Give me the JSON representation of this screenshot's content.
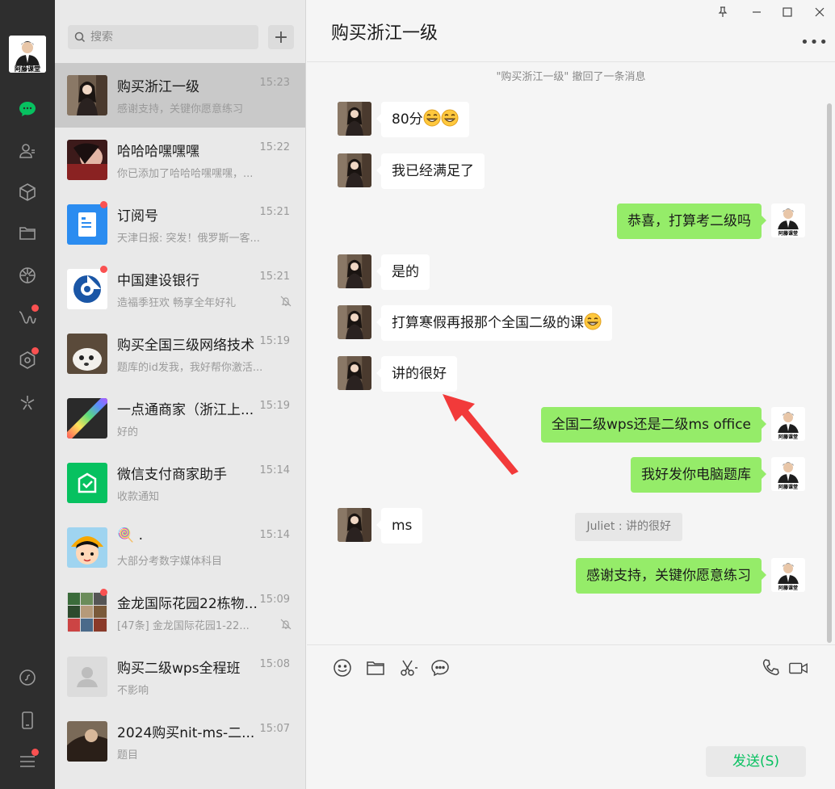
{
  "rail": {
    "my_avatar_text": "阿藤课堂",
    "items": [
      {
        "name": "chat-icon"
      },
      {
        "name": "contacts-icon"
      },
      {
        "name": "favorites-icon"
      },
      {
        "name": "files-icon"
      },
      {
        "name": "moments-icon"
      },
      {
        "name": "channels-icon"
      },
      {
        "name": "mini-programs-icon"
      },
      {
        "name": "search-discover-icon"
      }
    ],
    "bottom": [
      {
        "name": "mini-program-panel-icon"
      },
      {
        "name": "phone-icon"
      },
      {
        "name": "menu-icon"
      }
    ]
  },
  "search": {
    "placeholder": "搜索"
  },
  "conversations": [
    {
      "name": "购买浙江一级",
      "time": "15:23",
      "preview": "感谢支持，关键你愿意练习",
      "active": true
    },
    {
      "name": "哈哈哈嘿嘿嘿",
      "time": "15:22",
      "preview": "你已添加了哈哈哈嘿嘿嘿，..."
    },
    {
      "name": "订阅号",
      "time": "15:21",
      "preview": "天津日报: 突发！俄罗斯一客..."
    },
    {
      "name": "中国建设银行",
      "time": "15:21",
      "preview": "造福季狂欢 畅享全年好礼"
    },
    {
      "name": "购买全国三级网络技术",
      "time": "15:19",
      "preview": "题库的id发我，我好帮你激活..."
    },
    {
      "name": "一点通商家（浙江上...",
      "time": "15:19",
      "preview": "好的"
    },
    {
      "name": "微信支付商家助手",
      "time": "15:14",
      "preview": "收款通知"
    },
    {
      "name": "🍭 .",
      "time": "15:14",
      "preview": "大部分考数字媒体科目"
    },
    {
      "name": "金龙国际花园22栋物...",
      "time": "15:09",
      "preview": "[47条] 金龙国际花园1-22..."
    },
    {
      "name": "购买二级wps全程班",
      "time": "15:08",
      "preview": "不影响"
    },
    {
      "name": "2024购买nit-ms-二...",
      "time": "15:07",
      "preview": "题目"
    }
  ],
  "chat": {
    "title": "购买浙江一级",
    "recall_notice": "\"购买浙江一级\" 撤回了一条消息",
    "messages": [
      {
        "side": "left",
        "text": "80分",
        "emoji_count": 2
      },
      {
        "side": "left",
        "text": "我已经满足了"
      },
      {
        "side": "right",
        "text": "恭喜，打算考二级吗"
      },
      {
        "side": "left",
        "text": "是的"
      },
      {
        "side": "left",
        "text": "打算寒假再报那个全国二级的课",
        "emoji_count": 1
      },
      {
        "side": "left",
        "text": "讲的很好"
      },
      {
        "side": "right",
        "text": "全国二级wps还是二级ms office"
      },
      {
        "side": "right",
        "text": "我好发你电脑题库"
      },
      {
        "side": "left",
        "text": "ms"
      },
      {
        "side": "right",
        "text": "感谢支持，关键你愿意练习"
      }
    ],
    "quote": "Juliet : 讲的很好",
    "send_label": "发送(S)"
  },
  "colors": {
    "accent_green": "#07c160",
    "bubble_green": "#95ec69",
    "badge_red": "#fa5151",
    "annotation_arrow": "#f23a3a"
  }
}
